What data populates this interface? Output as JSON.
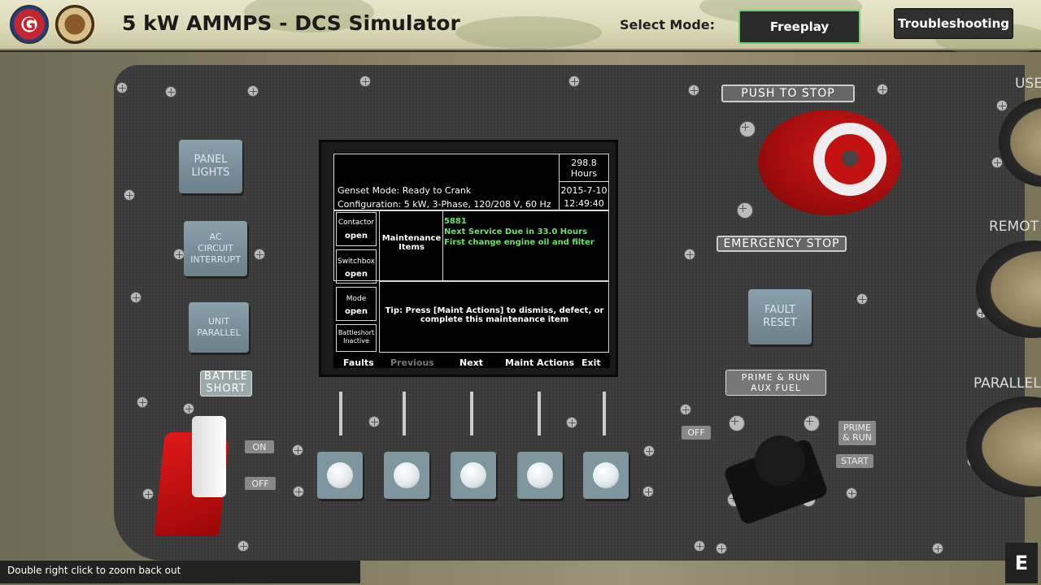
{
  "header": {
    "title": "5 kW AMMPS - DCS Simulator",
    "mode_label": "Select Mode:",
    "freeplay_label": "Freeplay",
    "troubleshooting_label": "Troubleshooting",
    "logo1_text": "G"
  },
  "panel": {
    "panel_lights": "PANEL\nLIGHTS",
    "ac_circuit_interrupt": "AC\nCIRCUIT\nINTERRUPT",
    "unit_parallel": "UNIT\nPARALLEL",
    "battle_short": "BATTLE\nSHORT",
    "on_label": "ON",
    "off_label": "OFF",
    "push_to_stop": "PUSH TO STOP",
    "emergency_stop": "EMERGENCY STOP",
    "fault_reset": "FAULT\nRESET",
    "prime_run_aux_fuel": "PRIME & RUN\nAUX FUEL",
    "selector_off": "OFF",
    "selector_prime_run": "PRIME\n& RUN",
    "selector_start": "START",
    "right_use": "USE",
    "right_remote": "REMOT",
    "right_parallel": "PARALLEL"
  },
  "display": {
    "hours_value": "298.8",
    "hours_unit": "Hours",
    "date": "2015-7-10",
    "time": "12:49:40",
    "genset_mode": "Genset Mode: Ready to Crank",
    "configuration": "Configuration:  5 kW, 3-Phase, 120/208 V, 60 Hz",
    "contactor_label": "Contactor",
    "contactor_value": "open",
    "switchbox_label": "Switchbox",
    "switchbox_value": "open",
    "mode_label": "Mode",
    "mode_value": "open",
    "battleshort_label": "Battleshort\nInactive",
    "maintenance_items": "Maintenance\nItems",
    "maint_code": "5881",
    "maint_line1": "Next Service Due in 33.0 Hours",
    "maint_line2": "First change engine oil and filter",
    "tip": "Tip: Press [Maint Actions] to dismiss, defect, or\ncomplete this maintenance item",
    "softkeys": {
      "faults": "Faults",
      "previous": "Previous",
      "next": "Next",
      "maint_actions": "Maint Actions",
      "exit": "Exit"
    }
  },
  "footer": {
    "status": "Double right click to zoom back out",
    "badge": "E"
  },
  "colors": {
    "accent_green": "#6cd16c",
    "estop_red": "#c21212",
    "screen_text_green": "#6ee06e"
  }
}
